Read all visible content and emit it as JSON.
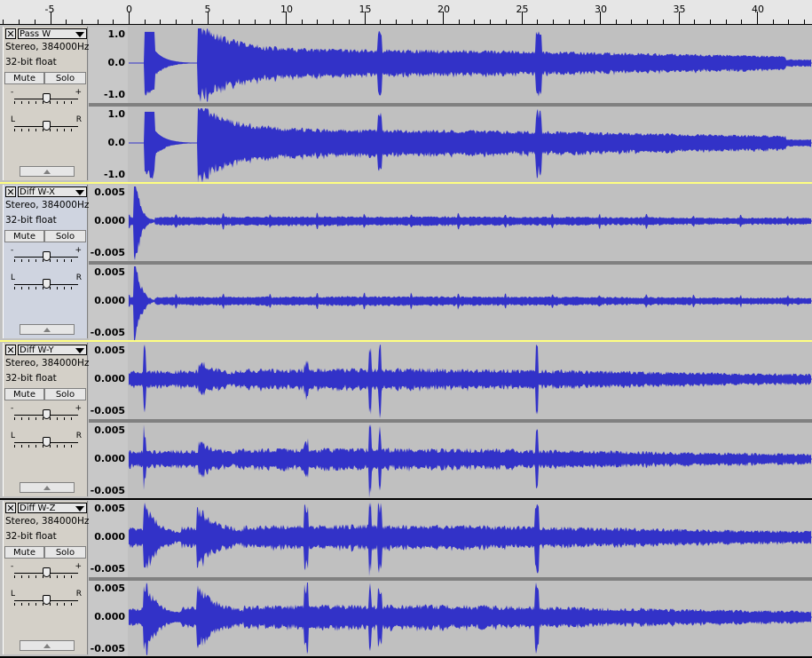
{
  "ruler": {
    "labels": [
      "-5",
      "0",
      "5",
      "10",
      "15",
      "20",
      "25",
      "30",
      "35",
      "40"
    ]
  },
  "colors": {
    "wave": "#3232c8",
    "background": "#c0c0c0"
  },
  "icons": {
    "close": "close-icon",
    "menu": "chevron-down-icon",
    "collapse": "triangle-up-icon"
  },
  "tracks": [
    {
      "name": "Pass W",
      "format": "Stereo, 384000Hz",
      "depth": "32-bit float",
      "mute": "Mute",
      "solo": "Solo",
      "gain_minus": "-",
      "gain_plus": "+",
      "pan_left": "L",
      "pan_right": "R",
      "selected": false,
      "scale": [
        "1.0",
        "0.0",
        "-1.0"
      ],
      "profile": "full"
    },
    {
      "name": "Diff W-X",
      "format": "Stereo, 384000Hz",
      "depth": "32-bit float",
      "mute": "Mute",
      "solo": "Solo",
      "gain_minus": "-",
      "gain_plus": "+",
      "pan_left": "L",
      "pan_right": "R",
      "selected": true,
      "scale": [
        "0.005",
        "0.000",
        "-0.005"
      ],
      "profile": "flat"
    },
    {
      "name": "Diff W-Y",
      "format": "Stereo, 384000Hz",
      "depth": "32-bit float",
      "mute": "Mute",
      "solo": "Solo",
      "gain_minus": "-",
      "gain_plus": "+",
      "pan_left": "L",
      "pan_right": "R",
      "selected": false,
      "scale": [
        "0.005",
        "0.000",
        "-0.005"
      ],
      "profile": "mid"
    },
    {
      "name": "Diff W-Z",
      "format": "Stereo, 384000Hz",
      "depth": "32-bit float",
      "mute": "Mute",
      "solo": "Solo",
      "gain_minus": "-",
      "gain_plus": "+",
      "pan_left": "L",
      "pan_right": "R",
      "selected": false,
      "scale": [
        "0.005",
        "0.000",
        "-0.005"
      ],
      "profile": "strong"
    }
  ]
}
